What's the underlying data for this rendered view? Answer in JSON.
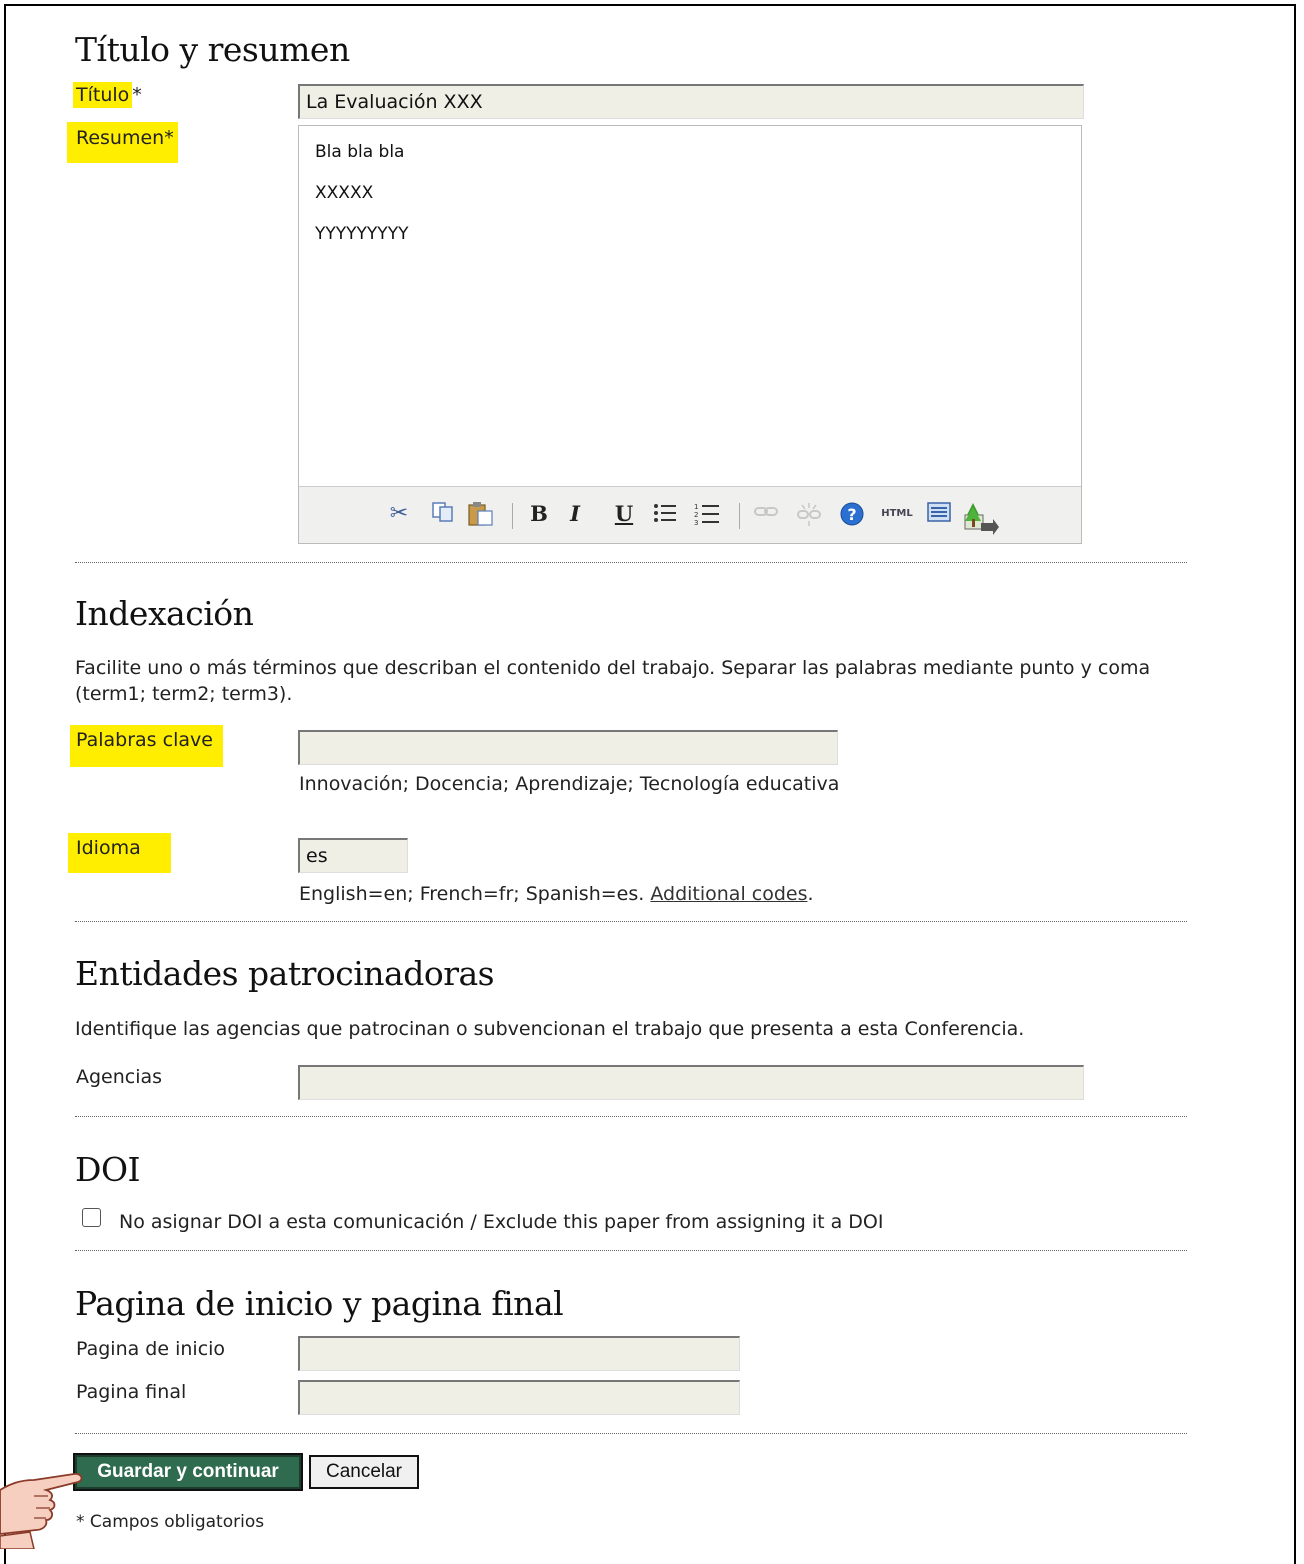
{
  "section_titulo": {
    "heading": "Título y resumen",
    "titulo_label": "Título",
    "required_mark": "*",
    "titulo_value": "La Evaluación XXX",
    "resumen_label": "Resumen",
    "resumen_lines": [
      "Bla bla bla",
      "XXXXX",
      "YYYYYYYYY"
    ]
  },
  "editor_toolbar": {
    "icons": [
      "cut-icon",
      "copy-icon",
      "paste-icon",
      "bold-icon",
      "italic-icon",
      "underline-icon",
      "bullet-list-icon",
      "numbered-list-icon",
      "link-icon",
      "unlink-icon",
      "help-icon",
      "html-icon",
      "fullscreen-icon",
      "image-icon"
    ],
    "bold": "B",
    "italic": "I",
    "underline": "U",
    "html": "HTML"
  },
  "section_indexacion": {
    "heading": "Indexación",
    "description": "Facilite uno o más términos que describan el contenido del trabajo. Separar las palabras mediante punto y coma (term1; term2; term3).",
    "keywords_label": "Palabras clave",
    "keywords_value": "",
    "keywords_hint": "Innovación; Docencia; Aprendizaje; Tecnología educativa",
    "language_label": "Idioma",
    "language_value": "es",
    "language_hint": "English=en; French=fr; Spanish=es.",
    "language_link": "Additional codes",
    "language_hint_end": "."
  },
  "section_entidades": {
    "heading": "Entidades patrocinadoras",
    "description": "Identifique las agencias que patrocinan o subvencionan el trabajo que presenta a esta Conferencia.",
    "agencias_label": "Agencias",
    "agencias_value": ""
  },
  "section_doi": {
    "heading": "DOI",
    "checkbox_label": "No asignar DOI a esta comunicación / Exclude this paper from assigning it a DOI",
    "checked": false
  },
  "section_paginas": {
    "heading": "Pagina de inicio y pagina final",
    "inicio_label": "Pagina de inicio",
    "inicio_value": "",
    "final_label": "Pagina final",
    "final_value": ""
  },
  "actions": {
    "save_label": "Guardar y continuar",
    "cancel_label": "Cancelar",
    "required_note": "* Campos obligatorios"
  },
  "colors": {
    "highlight": "#ffee00",
    "save_button": "#2e6b4f",
    "input_bg": "#efefe6"
  }
}
